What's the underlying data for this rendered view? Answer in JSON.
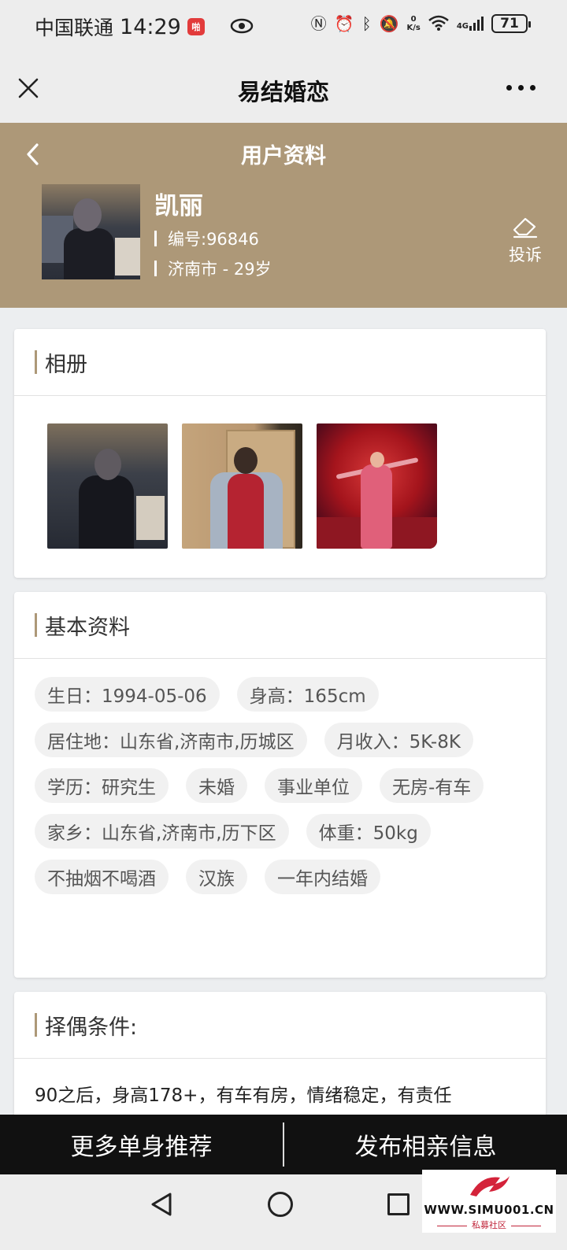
{
  "status_bar": {
    "carrier": "中国联通",
    "time": "14:29",
    "app_badge": "啪",
    "net_speed_value": "0",
    "net_speed_unit": "K/s",
    "signal_label": "4G",
    "battery": "71"
  },
  "title_bar": {
    "title": "易结婚恋"
  },
  "profile": {
    "page_title": "用户资料",
    "name": "凯丽",
    "id_text": "编号:96846",
    "location_age": "济南市 - 29岁",
    "report_label": "投诉"
  },
  "album": {
    "title": "相册",
    "photos": [
      "photo-1",
      "photo-2",
      "photo-3"
    ]
  },
  "basic_info": {
    "title": "基本资料",
    "tags": [
      "生日：1994-05-06",
      "身高：165cm",
      "居住地：山东省,济南市,历城区",
      "月收入：5K-8K",
      "学历：研究生",
      "未婚",
      "事业单位",
      "无房-有车",
      "家乡：山东省,济南市,历下区",
      "体重：50kg",
      "不抽烟不喝酒",
      "汉族",
      "一年内结婚"
    ]
  },
  "requirements": {
    "title": "择偶条件:",
    "text": "90之后，身高178+，有车有房，情绪稳定，有责任"
  },
  "actions": {
    "more_singles": "更多单身推荐",
    "publish": "发布相亲信息"
  },
  "watermark": {
    "url": "WWW.SIMU001.CN",
    "sub": "私募社区"
  },
  "colors": {
    "header_bg": "#ad9878",
    "accent": "#ad9878",
    "action_bar_bg": "#111111"
  }
}
